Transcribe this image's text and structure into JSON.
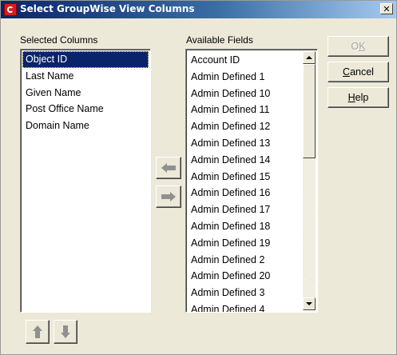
{
  "window": {
    "title": "Select GroupWise View Columns",
    "close_glyph": "✕"
  },
  "selected_columns": {
    "label": "Selected Columns",
    "items": [
      "Object ID",
      "Last Name",
      "Given Name",
      "Post Office Name",
      "Domain Name"
    ],
    "selected_index": 0
  },
  "available_fields": {
    "label": "Available Fields",
    "items": [
      "Account ID",
      "Admin Defined 1",
      "Admin Defined 10",
      "Admin Defined 11",
      "Admin Defined 12",
      "Admin Defined 13",
      "Admin Defined 14",
      "Admin Defined 15",
      "Admin Defined 16",
      "Admin Defined 17",
      "Admin Defined 18",
      "Admin Defined 19",
      "Admin Defined 2",
      "Admin Defined 20",
      "Admin Defined 3",
      "Admin Defined 4"
    ]
  },
  "buttons": {
    "ok": {
      "pre": "O",
      "mnemonic": "K",
      "post": "",
      "enabled": false
    },
    "cancel": {
      "pre": "",
      "mnemonic": "C",
      "post": "ancel"
    },
    "help": {
      "pre": "",
      "mnemonic": "H",
      "post": "elp"
    }
  },
  "icons": {
    "move_left": "arrow-left-icon",
    "move_right": "arrow-right-icon",
    "move_up": "arrow-up-icon",
    "move_down": "arrow-down-icon",
    "app": "groupwise-app-icon"
  },
  "colors": {
    "title_bar_start": "#0a246a",
    "selection": "#0a246a",
    "dialog_bg": "#ece9d8",
    "arrow_gray": "#909090"
  }
}
